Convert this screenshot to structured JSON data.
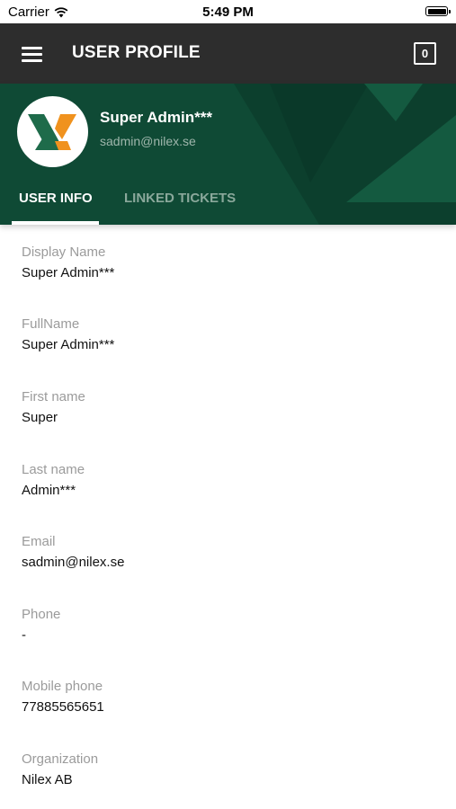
{
  "status_bar": {
    "carrier": "Carrier",
    "time": "5:49 PM"
  },
  "app_bar": {
    "title": "USER PROFILE",
    "badge_count": "0"
  },
  "profile": {
    "name": "Super Admin***",
    "email": "sadmin@nilex.se"
  },
  "tabs": [
    {
      "label": "USER INFO",
      "active": true
    },
    {
      "label": "LINKED TICKETS",
      "active": false
    }
  ],
  "fields": [
    {
      "label": "Display Name",
      "value": "Super Admin***"
    },
    {
      "label": "FullName",
      "value": "Super Admin***"
    },
    {
      "label": "First name",
      "value": "Super"
    },
    {
      "label": "Last name",
      "value": "Admin***"
    },
    {
      "label": "Email",
      "value": "sadmin@nilex.se"
    },
    {
      "label": "Phone",
      "value": "-"
    },
    {
      "label": "Mobile phone",
      "value": "77885565651"
    },
    {
      "label": "Organization",
      "value": "Nilex AB"
    }
  ],
  "colors": {
    "header_green": "#0f4a35",
    "app_bar": "#2d2d2d",
    "logo_orange": "#f0921e"
  }
}
